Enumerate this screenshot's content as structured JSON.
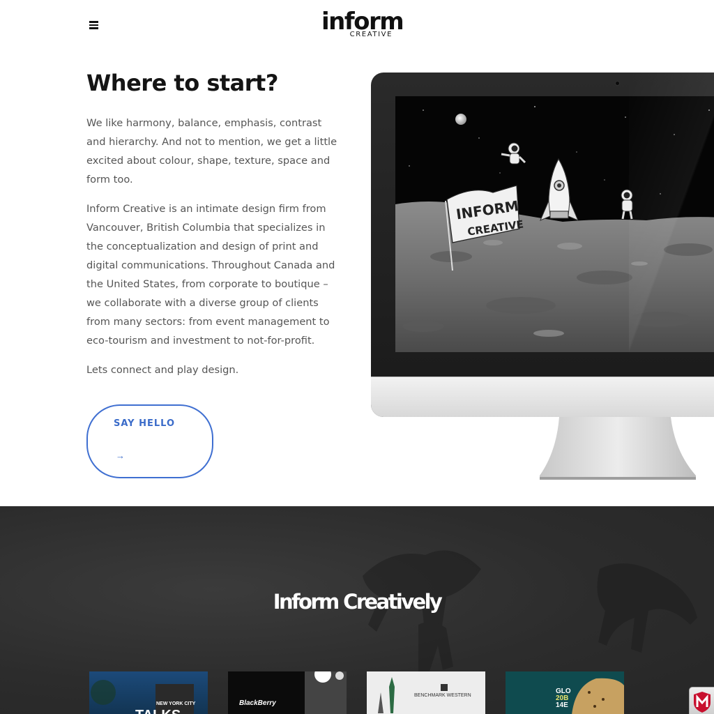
{
  "header": {
    "logo_main": "inform",
    "logo_sub": "CREATIVE"
  },
  "intro": {
    "headline": "Where to start?",
    "paragraph_1": "We like harmony, balance, emphasis, contrast and hierarchy. And not to mention, we get a little excited about colour, shape, texture, space and form too.",
    "paragraph_2": "Inform Creative is an intimate design firm from Vancouver, British Columbia that specializes in the conceptualization and design of print and digital communications. Throughout Canada and the United States, from corporate to boutique – we collaborate with a diverse group of clients from many sectors: from event management to eco-tourism and investment to not-for-profit.",
    "paragraph_3": "Lets connect and play design.",
    "cta_label": "SAY HELLO",
    "cta_arrow": "→"
  },
  "monitor_screen": {
    "flag_line_1": "INFORM",
    "flag_line_2": "CREATIVE"
  },
  "work": {
    "title": "Inform Creatively",
    "thumbnails": [
      {
        "text_1": "NEW YORK CITY",
        "text_2": "TALKS"
      },
      {
        "text_1": "BlackBerry"
      },
      {
        "text_1": "BENCHMARK WESTERN"
      },
      {
        "text_1": "GLO",
        "text_2": "20B",
        "text_3": "14E"
      }
    ]
  },
  "colors": {
    "accent": "#3f6fd1",
    "headline": "#141414",
    "body_text": "#555555",
    "dark_bg": "#2c2c2c"
  },
  "icons": {
    "menu": "hamburger-menu-icon",
    "badge": "mcafee-shield-icon"
  }
}
